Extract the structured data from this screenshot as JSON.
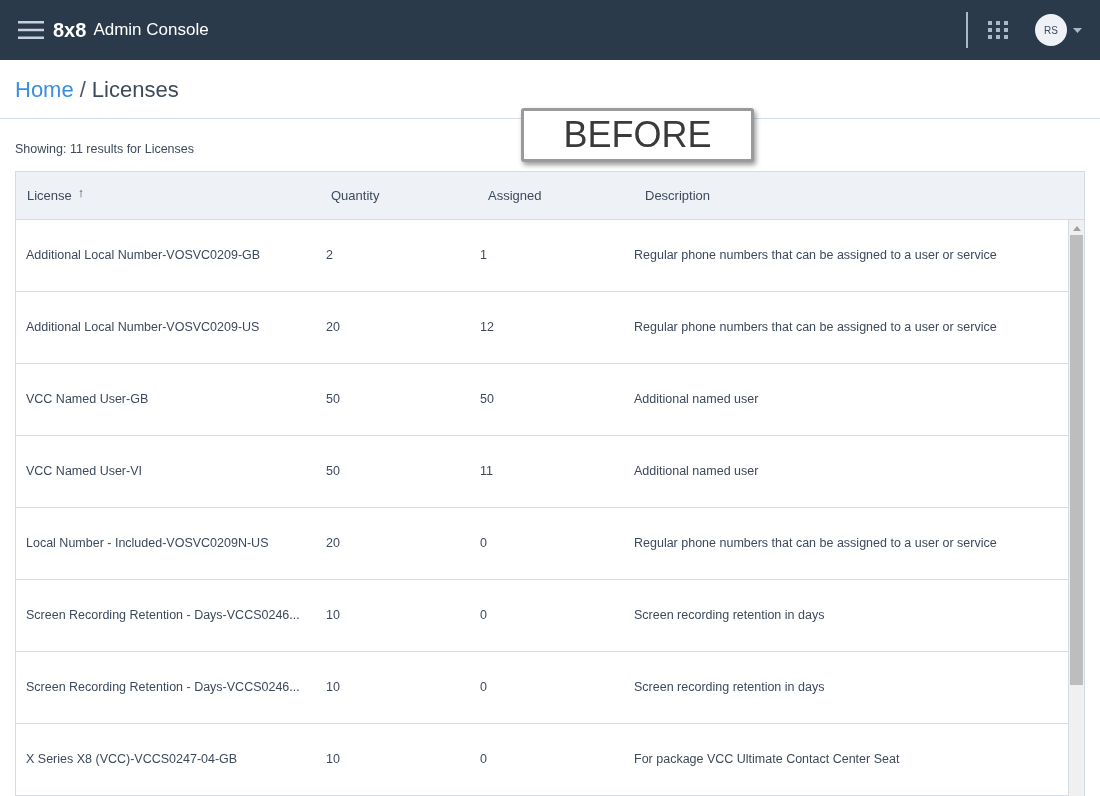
{
  "header": {
    "logo": "8x8",
    "title": "Admin Console",
    "avatar": "RS"
  },
  "breadcrumb": {
    "home": "Home",
    "separator": "/",
    "current": "Licenses"
  },
  "annotation": "BEFORE",
  "results_text": "Showing: 11 results for Licenses",
  "table": {
    "columns": [
      {
        "label": "License",
        "sort": "↑"
      },
      {
        "label": "Quantity"
      },
      {
        "label": "Assigned"
      },
      {
        "label": "Description"
      }
    ],
    "rows": [
      [
        "Additional Local Number-VOSVC0209-GB",
        "2",
        "1",
        "Regular phone numbers that can be assigned to a user or service"
      ],
      [
        "Additional Local Number-VOSVC0209-US",
        "20",
        "12",
        "Regular phone numbers that can be assigned to a user or service"
      ],
      [
        "VCC Named User-GB",
        "50",
        "50",
        "Additional named user"
      ],
      [
        "VCC Named User-VI",
        "50",
        "11",
        "Additional named user"
      ],
      [
        "Local Number - Included-VOSVC0209N-US",
        "20",
        "0",
        "Regular phone numbers that can be assigned to a user or service"
      ],
      [
        "Screen Recording Retention - Days-VCCS0246...",
        "10",
        "0",
        "Screen recording retention in days"
      ],
      [
        "Screen Recording Retention - Days-VCCS0246...",
        "10",
        "0",
        "Screen recording retention in days"
      ],
      [
        "X Series X8 (VCC)-VCCS0247-04-GB",
        "10",
        "0",
        "For package VCC Ultimate Contact Center Seat"
      ]
    ]
  }
}
